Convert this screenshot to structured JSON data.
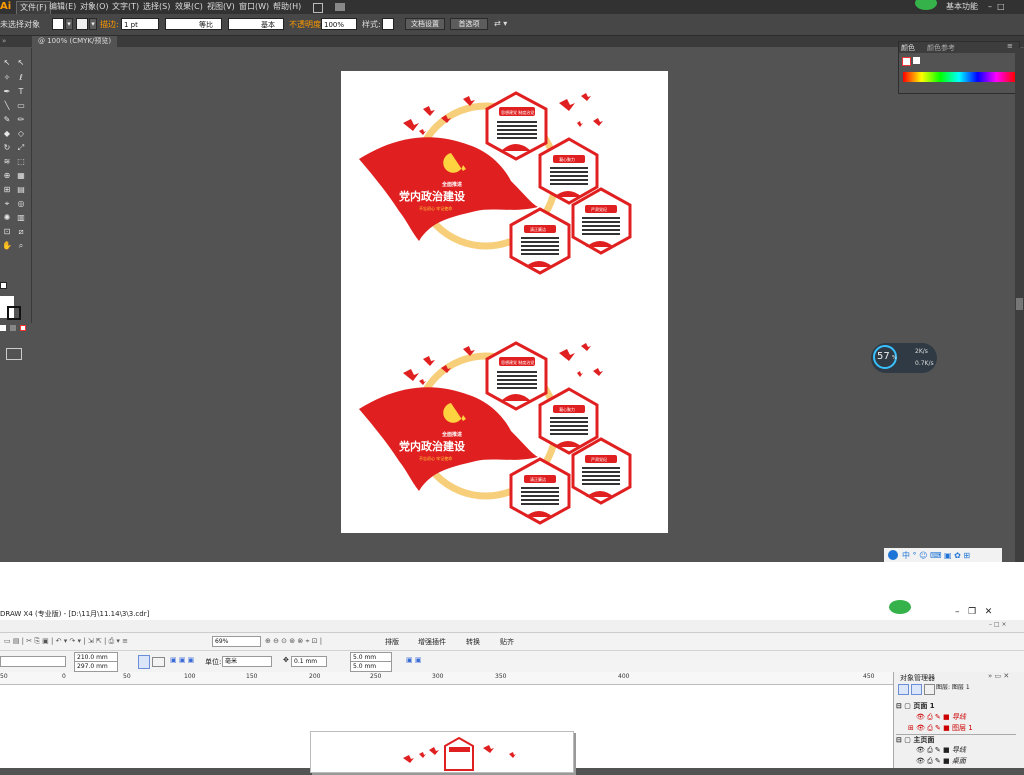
{
  "illustrator": {
    "logo": "Ai",
    "menu": [
      "文件(F)",
      "编辑(E)",
      "对象(O)",
      "文字(T)",
      "选择(S)",
      "效果(C)",
      "视图(V)",
      "窗口(W)",
      "帮助(H)"
    ],
    "workspace": "基本功能",
    "control": {
      "selection": "未选择对象",
      "stroke_label": "描边:",
      "stroke_value": "1 pt",
      "profile": "等比",
      "brush": "基本",
      "opacity_label": "不透明度:",
      "opacity_value": "100%",
      "style_label": "样式:",
      "doc_setup": "文档设置",
      "prefs": "首选项"
    },
    "doc_tab": "@ 100% (CMYK/预览)",
    "panel": {
      "tab1": "颜色",
      "tab2": "颜色参考"
    },
    "network": {
      "percent": "57",
      "unit": "%",
      "up": "2K/s",
      "down": "0.7K/s"
    }
  },
  "design": {
    "banner_small": "全面推进",
    "banner_main": "党内政治建设",
    "banner_sub": "不忘初心 牢记使命",
    "hex1_title": "思想建党 制度治党",
    "hex2_title": "凝心聚力",
    "hex3_title": "严肃党纪",
    "hex4_title": "清正廉洁"
  },
  "coreldraw": {
    "title": "DRAW X4 (专业版) - [D:\\11月\\11.14\\3\\3.cdr]",
    "zoom": "69%",
    "toolbar_items": [
      "排版",
      "增强插件",
      "转换",
      "贴齐"
    ],
    "width": "210.0 mm",
    "height": "297.0 mm",
    "unit_label": "单位:",
    "unit_value": "毫米",
    "nudge": "0.1 mm",
    "dup_x": "5.0 mm",
    "dup_y": "5.0 mm",
    "ruler_ticks": [
      "50",
      "0",
      "50",
      "100",
      "150",
      "200",
      "250",
      "300",
      "350",
      "400",
      "450"
    ],
    "docker_title": "对象管理器",
    "docker_rows": [
      {
        "name": "页面 1"
      },
      {
        "name": "导线"
      },
      {
        "name": "图层 1"
      },
      {
        "name": "主页面"
      },
      {
        "name": "导线"
      },
      {
        "name": "桌面"
      }
    ],
    "docker_header": "图层: 图层 1"
  },
  "colors": {
    "red": "#e02020",
    "gold": "#f7cf7a",
    "ai_bg": "#535353",
    "ai_dark": "#323232"
  }
}
